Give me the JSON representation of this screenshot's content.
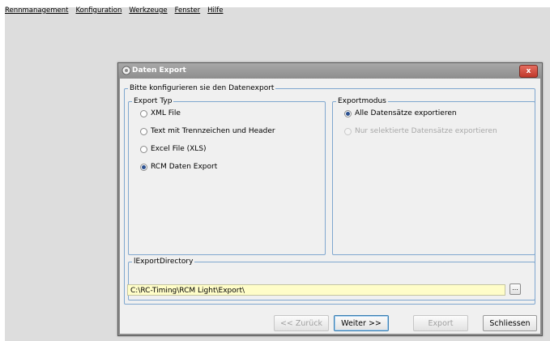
{
  "menu": [
    "Rennmanagement",
    "Konfiguration",
    "Werkzeuge",
    "Fenster",
    "Hilfe"
  ],
  "dialog": {
    "title": "Daten Export",
    "close_label": "x",
    "main_group": "Bitte konfigurieren sie den Datenexport",
    "export_type": {
      "legend": "Export Typ",
      "options": [
        {
          "label": "XML File",
          "checked": false
        },
        {
          "label": "Text mit Trennzeichen und Header",
          "checked": false
        },
        {
          "label": "Excel File (XLS)",
          "checked": false
        },
        {
          "label": "RCM Daten Export",
          "checked": true
        }
      ]
    },
    "export_mode": {
      "legend": "Exportmodus",
      "options": [
        {
          "label": "Alle Datensätze exportieren",
          "checked": true,
          "enabled": true
        },
        {
          "label": "Nur selektierte Datensätze exportieren",
          "checked": false,
          "enabled": false
        }
      ]
    },
    "directory": {
      "legend": "lExportDirectory",
      "value": "C:\\RC-Timing\\RCM Light\\Export\\",
      "browse_label": "..."
    },
    "buttons": {
      "back": "<< Zurück",
      "next": "Weiter >>",
      "export": "Export",
      "close": "Schliessen"
    }
  }
}
